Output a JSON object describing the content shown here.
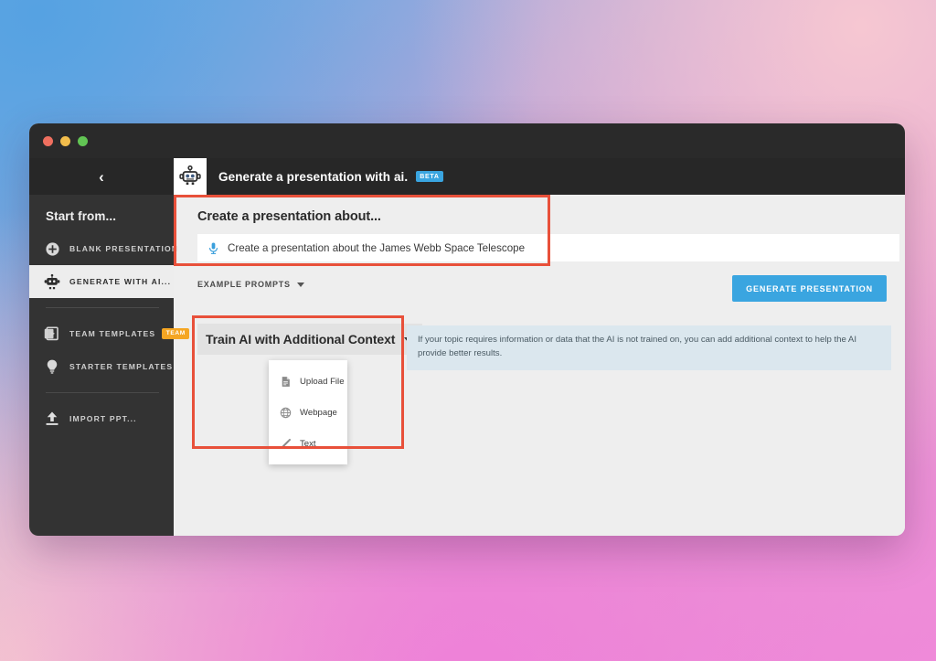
{
  "window": {
    "traffic_lights": [
      "close",
      "minimize",
      "maximize"
    ]
  },
  "sidebar": {
    "back_icon": "chevron-left-icon",
    "back_glyph": "‹",
    "section_title": "Start from...",
    "items": [
      {
        "label": "Blank Presentation",
        "icon": "plus-circle-icon",
        "active": false
      },
      {
        "label": "Generate with ai...",
        "icon": "robot-icon",
        "active": true
      },
      {
        "label": "Team Templates",
        "icon": "slides-stack-icon",
        "active": false,
        "badge": "TEAM"
      },
      {
        "label": "Starter Templates",
        "icon": "lightbulb-icon",
        "active": false
      },
      {
        "label": "Import PPT...",
        "icon": "upload-arrow-icon",
        "active": false
      }
    ]
  },
  "header": {
    "icon": "robot-icon",
    "title": "Generate a presentation with ai.",
    "badge": "BETA"
  },
  "main": {
    "prompt_title": "Create a presentation about...",
    "prompt_icon": "microphone-icon",
    "prompt_value": "Create a presentation about the James Webb Space Telescope",
    "prompt_placeholder": "Create a presentation about...",
    "example_prompts_label": "Example Prompts",
    "example_prompts_caret": "chevron-down-icon",
    "generate_button": "Generate Presentation",
    "train_button": "Train AI with Additional Context",
    "train_caret": "chevron-down-icon",
    "info_text": "If your topic requires information or data that the AI is not trained on, you can add additional context to help the AI provide better results.",
    "dropdown": {
      "items": [
        {
          "label": "Upload File",
          "icon": "document-icon"
        },
        {
          "label": "Webpage",
          "icon": "globe-icon"
        },
        {
          "label": "Text",
          "icon": "pencil-icon"
        }
      ]
    }
  },
  "annotations": [
    {
      "name": "prompt-highlight",
      "color": "#e8503a"
    },
    {
      "name": "train-context-highlight",
      "color": "#e8503a"
    }
  ],
  "colors": {
    "accent_blue": "#3aa5e0",
    "badge_orange": "#f5a623",
    "annotation_red": "#e8503a",
    "sidebar_bg": "#333333",
    "chrome_bg": "#272727",
    "panel_bg": "#eeeeee",
    "info_bg": "#dbe7ee"
  }
}
